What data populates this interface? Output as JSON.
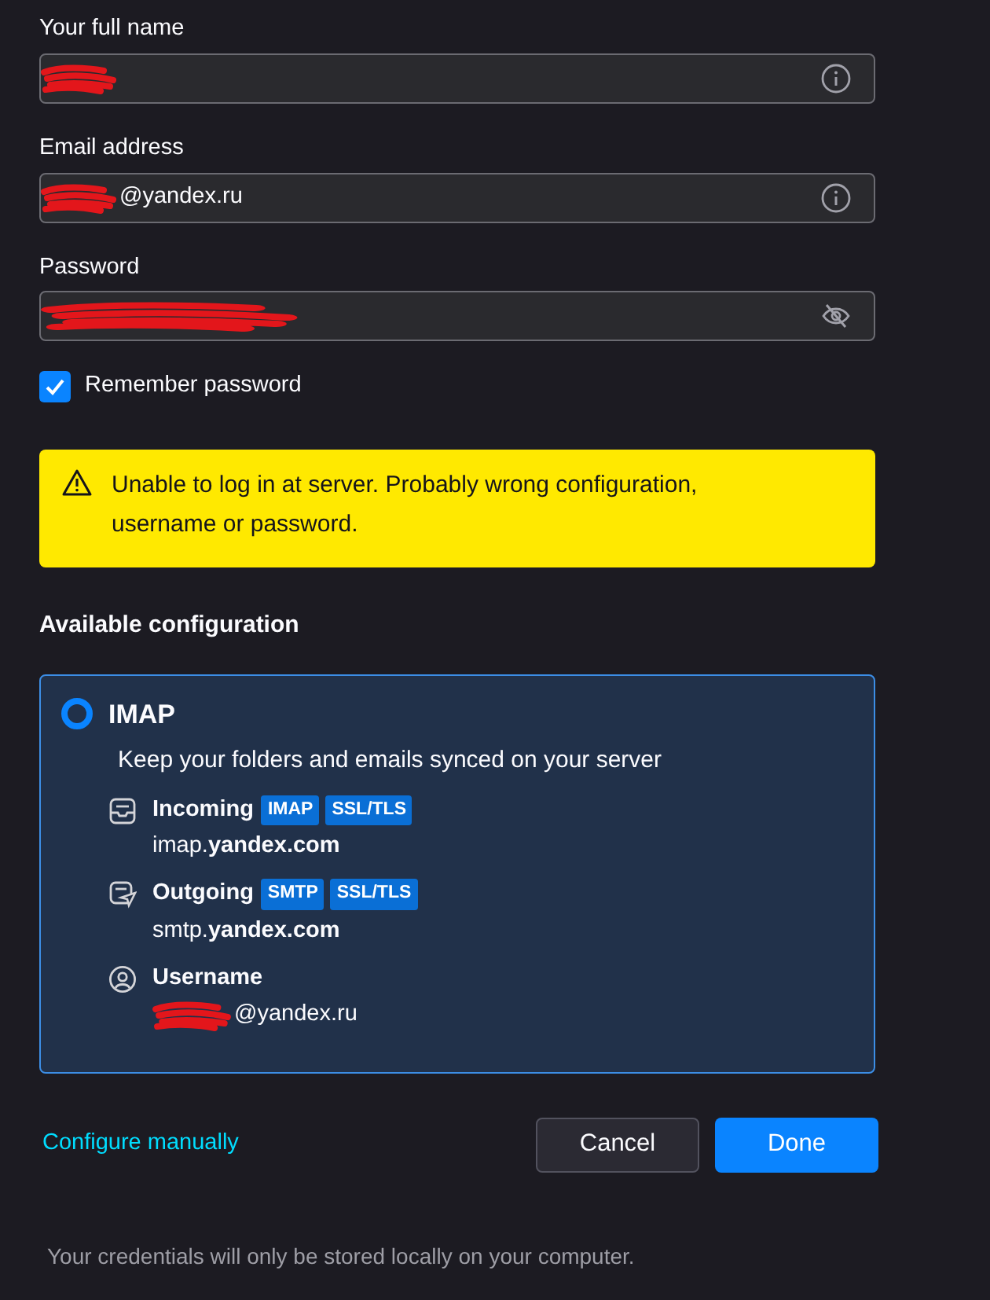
{
  "fields": [
    {
      "kind": "text",
      "label": "Your full name",
      "redacted": true
    },
    {
      "kind": "text",
      "label": "Email address",
      "value": "@yandex.ru",
      "redacted": true
    },
    {
      "kind": "password",
      "label": "Password",
      "redacted": true
    }
  ],
  "remember_password": {
    "label": "Remember password",
    "checked": true
  },
  "warning": {
    "text": "Unable to log in at server. Probably wrong configuration, username or password."
  },
  "config": {
    "heading": "Available configuration",
    "options": [
      {
        "name": "IMAP",
        "selected": true,
        "description": "Keep your folders and emails synced on your server",
        "servers": [
          {
            "kind": "incoming",
            "label": "Incoming",
            "badges": [
              "IMAP",
              "SSL/TLS"
            ],
            "host": "imap.**yandex.com**",
            "redacted": false
          },
          {
            "kind": "outgoing",
            "label": "Outgoing",
            "badges": [
              "SMTP",
              "SSL/TLS"
            ],
            "host": "smtp.**yandex.com**",
            "redacted": false
          },
          {
            "kind": "username",
            "label": "Username",
            "host": "@yandex.ru",
            "redacted": true
          }
        ]
      }
    ]
  },
  "configure_manually": "Configure manually",
  "buttons": [
    {
      "label": "Cancel",
      "kind": "secondary"
    },
    {
      "label": "Done",
      "kind": "primary"
    }
  ],
  "footer": "Your credentials will only be stored locally on your computer."
}
